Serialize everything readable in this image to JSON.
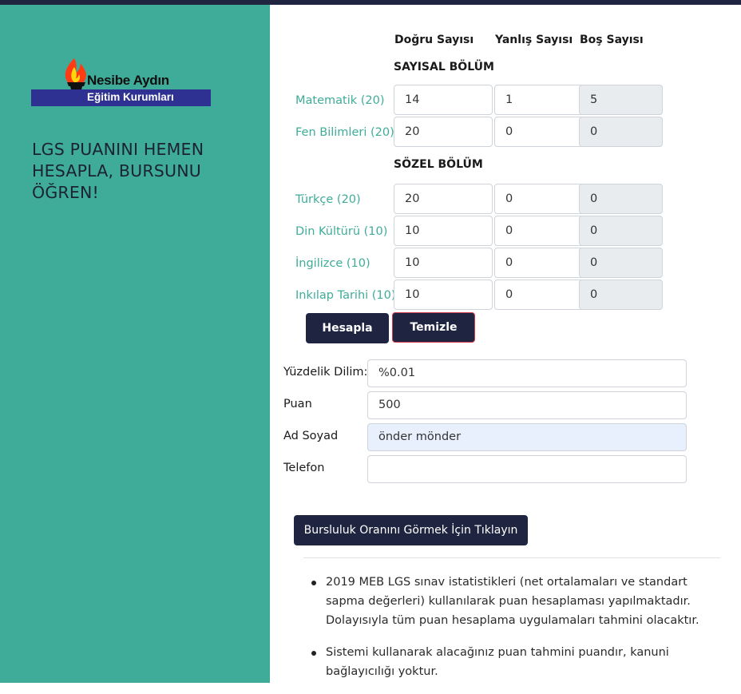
{
  "brand": {
    "name": "Nesibe Aydın",
    "subtitle": "Eğitim Kurumları",
    "slogan": "LGS PUANINI HEMEN HESAPLA, BURSUNU ÖĞREN!"
  },
  "columns": {
    "correct": "Doğru Sayısı",
    "wrong": "Yanlış Sayısı",
    "blank": "Boş Sayısı"
  },
  "sections": [
    {
      "title": "SAYISAL BÖLÜM",
      "rows": [
        {
          "label": "Matematik (20)",
          "correct": "14",
          "wrong": "1",
          "blank": "5"
        },
        {
          "label": "Fen Bilimleri (20)",
          "correct": "20",
          "wrong": "0",
          "blank": "0"
        }
      ]
    },
    {
      "title": "SÖZEL BÖLÜM",
      "rows": [
        {
          "label": "Türkçe (20)",
          "correct": "20",
          "wrong": "0",
          "blank": "0"
        },
        {
          "label": "Din Kültürü (10)",
          "correct": "10",
          "wrong": "0",
          "blank": "0"
        },
        {
          "label": "İngilizce (10)",
          "correct": "10",
          "wrong": "0",
          "blank": "0"
        },
        {
          "label": "Inkılap Tarihi (10)",
          "correct": "10",
          "wrong": "0",
          "blank": "0"
        }
      ]
    }
  ],
  "buttons": {
    "calculate": "Hesapla",
    "clear": "Temizle",
    "scholarship": "Bursluluk Oranını Görmek İçin Tıklayın"
  },
  "results": [
    {
      "label": "Yüzdelik Dilim:",
      "value": "%0.01"
    },
    {
      "label": "Puan",
      "value": "500"
    },
    {
      "label": "Ad Soyad",
      "value": "önder mönder"
    },
    {
      "label": "Telefon",
      "value": ""
    }
  ],
  "notes": [
    "2019 MEB LGS sınav istatistikleri (net ortalamaları ve standart sapma değerleri) kullanılarak puan hesaplaması yapılmaktadır. Dolayısıyla tüm puan hesaplama uygulamaları tahmini olacaktır.",
    "Sistemi kullanarak alacağınız puan tahmini puandır, kanuni bağlayıcılığı yoktur."
  ],
  "colors": {
    "panel": "#3fac99",
    "navy": "#1f2541",
    "brand_blue": "#2e3192"
  }
}
